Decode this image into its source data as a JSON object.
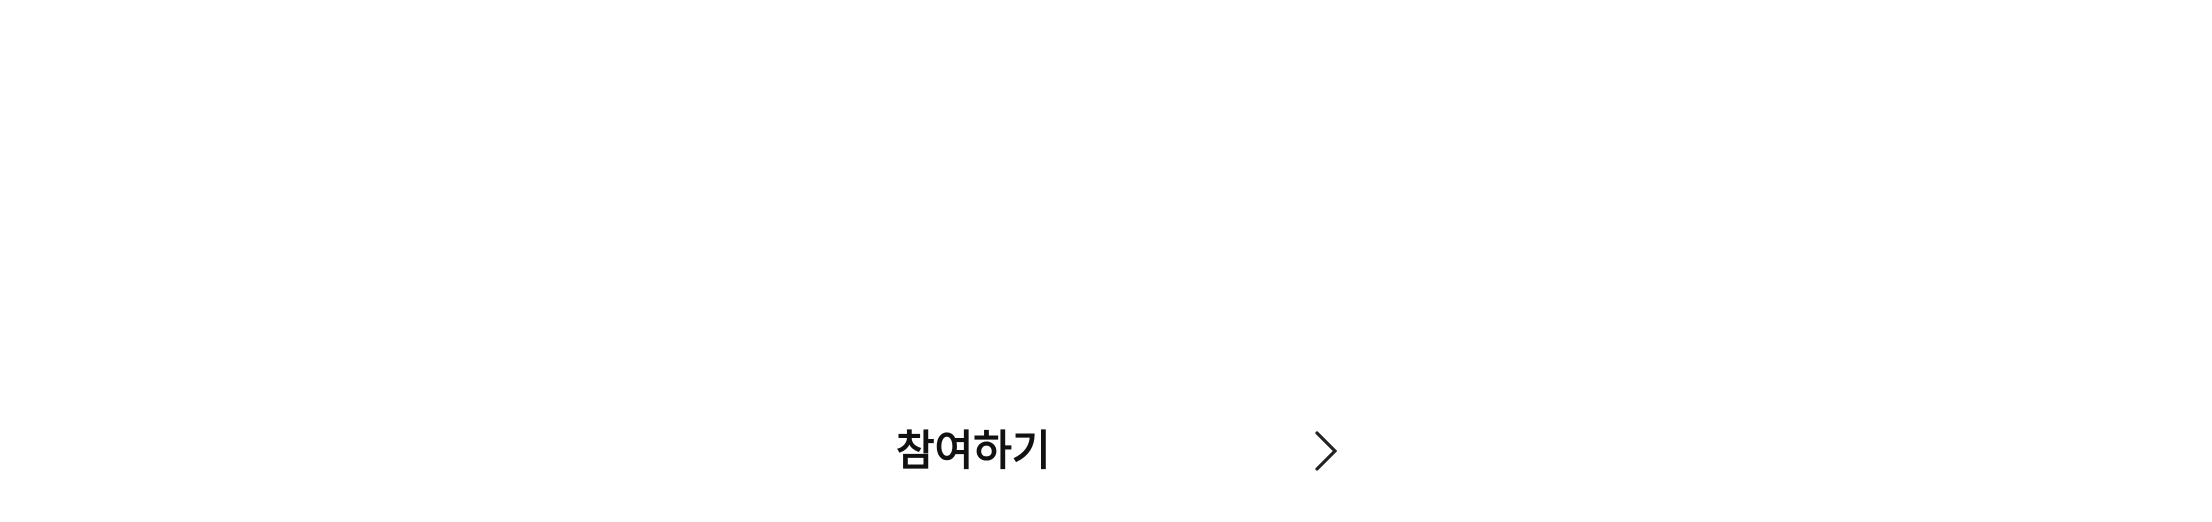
{
  "join": {
    "label": "참여하기",
    "icon": "chevron-right-icon"
  },
  "colors": {
    "background": "#ffffff",
    "text": "#111111",
    "icon": "#222222"
  }
}
